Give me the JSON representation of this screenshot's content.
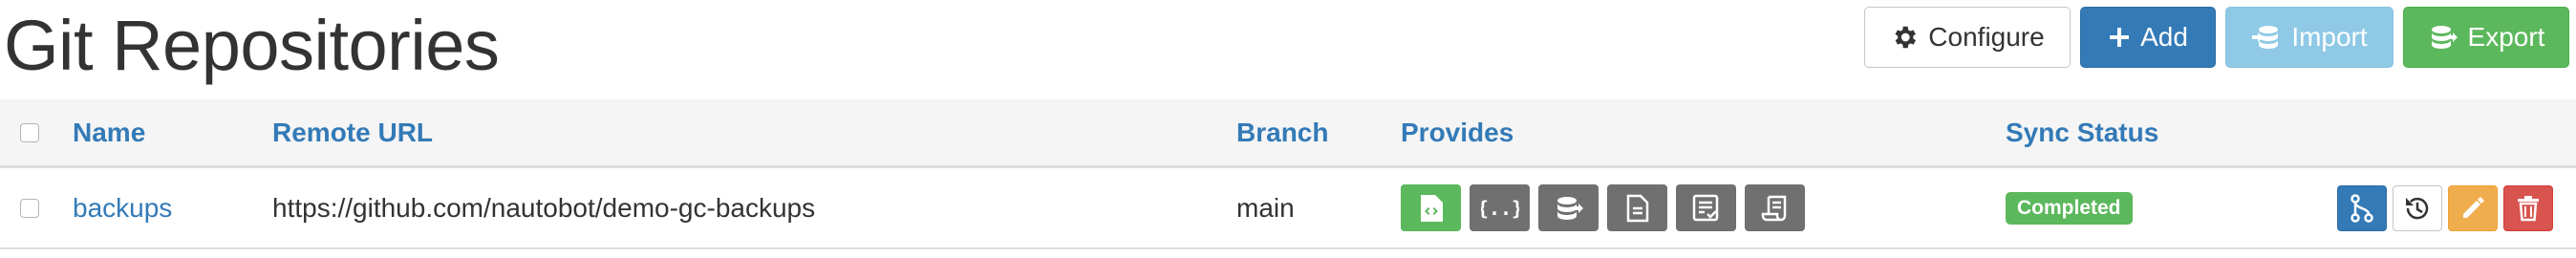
{
  "page": {
    "title": "Git Repositories"
  },
  "toolbar": {
    "configure_label": "Configure",
    "add_label": "Add",
    "import_label": "Import",
    "export_label": "Export"
  },
  "table": {
    "columns": [
      "Name",
      "Remote URL",
      "Branch",
      "Provides",
      "Sync Status"
    ],
    "rows": [
      {
        "name": "backups",
        "remote_url": "https://github.com/nautobot/demo-gc-backups",
        "branch": "main",
        "provides_icons": [
          "code-file-icon",
          "json-braces-icon",
          "database-export-icon",
          "document-icon",
          "checklist-icon",
          "scroll-icon"
        ],
        "sync_status": "Completed"
      }
    ]
  },
  "colors": {
    "primary": "#337ab7",
    "success": "#5cb85c",
    "info": "#8fc9e6",
    "warning": "#f0ad4e",
    "danger": "#d9534f",
    "muted_icon_bg": "#707070"
  }
}
